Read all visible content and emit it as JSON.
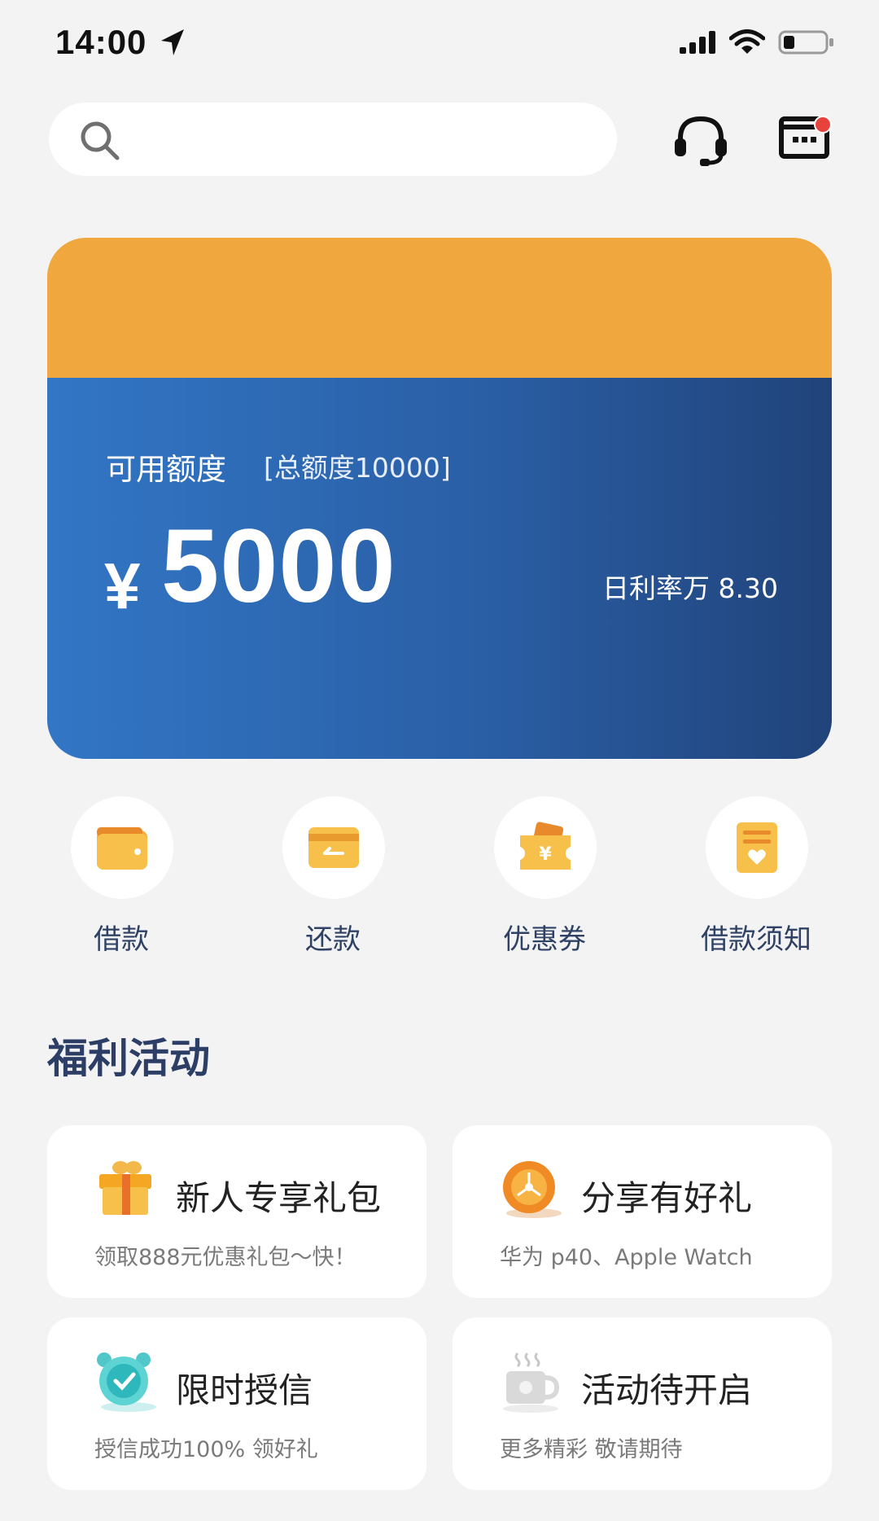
{
  "status_bar": {
    "time": "14:00"
  },
  "header": {
    "search_placeholder": "",
    "icons": [
      "search-icon",
      "customer-service-icon",
      "message-icon"
    ]
  },
  "credit": {
    "available_label": "可用额度",
    "total_label": "[总额度10000]",
    "currency": "¥",
    "amount": "5000",
    "rate_label": "日利率万 8.30",
    "colors": {
      "top": "#f0a83e",
      "gradient_start": "#3276c5",
      "gradient_end": "#21437a"
    }
  },
  "quick_actions": [
    {
      "label": "借款",
      "icon": "wallet-icon"
    },
    {
      "label": "还款",
      "icon": "card-return-icon"
    },
    {
      "label": "优惠券",
      "icon": "coupon-icon"
    },
    {
      "label": "借款须知",
      "icon": "notice-icon"
    }
  ],
  "section": {
    "title": "福利活动"
  },
  "promos": [
    {
      "title": "新人专享礼包",
      "subtitle": "领取888元优惠礼包～快！",
      "icon": "gift-icon"
    },
    {
      "title": "分享有好礼",
      "subtitle": "华为 p40、Apple Watch",
      "icon": "share-wheel-icon"
    },
    {
      "title": "限时授信",
      "subtitle": "授信成功100% 领好礼",
      "icon": "alarm-clock-icon"
    },
    {
      "title": "活动待开启",
      "subtitle": "更多精彩 敬请期待",
      "icon": "coffee-cup-icon"
    }
  ]
}
